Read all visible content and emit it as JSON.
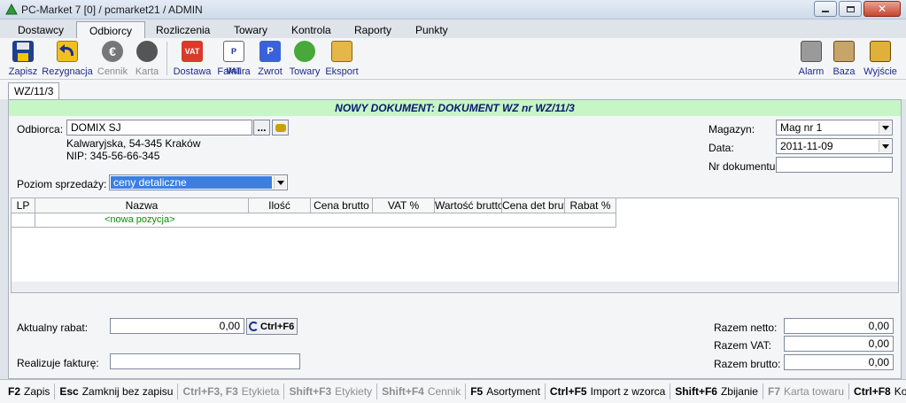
{
  "window": {
    "title": "PC-Market 7 [0] / pcmarket21 / ADMIN"
  },
  "menu": [
    {
      "label": "Dostawcy"
    },
    {
      "label": "Odbiorcy",
      "active": true
    },
    {
      "label": "Rozliczenia"
    },
    {
      "label": "Towary"
    },
    {
      "label": "Kontrola"
    },
    {
      "label": "Raporty"
    },
    {
      "label": "Punkty"
    }
  ],
  "toolbar": {
    "zapisz": "Zapisz",
    "rezygnacja": "Rezygnacja",
    "cennik": "Cennik",
    "karta": "Karta",
    "dostawa": "Dostawa",
    "faktura": "Faktura",
    "zwrot": "Zwrot",
    "towary": "Towary",
    "eksport": "Eksport",
    "alarm": "Alarm",
    "baza": "Baza",
    "wyjscie": "Wyjście"
  },
  "doc_tab": "WZ/11/3",
  "header": "NOWY DOKUMENT: DOKUMENT WZ nr WZ/11/3",
  "odbiorca": {
    "label": "Odbiorca:",
    "value": "DOMIX SJ",
    "address": "Kalwaryjska, 54-345 Kraków",
    "nip": "NIP: 345-56-66-345",
    "dots": "..."
  },
  "poziom": {
    "label": "Poziom sprzedaży:",
    "value": "ceny detaliczne"
  },
  "magazyn": {
    "label": "Magazyn:",
    "value": "Mag nr 1"
  },
  "data": {
    "label": "Data:",
    "value": "2011-11-09"
  },
  "nr_dok": {
    "label": "Nr dokumentu:",
    "value": ""
  },
  "grid": {
    "columns": [
      "LP",
      "Nazwa",
      "Ilość",
      "Cena brutto",
      "VAT %",
      "Wartość brutto",
      "Cena det brutto",
      "Rabat %"
    ],
    "new_row": "<nowa pozycja>"
  },
  "rabat": {
    "label": "Aktualny rabat:",
    "value": "0,00",
    "button": "Ctrl+F6"
  },
  "realizuje": {
    "label": "Realizuje fakturę:",
    "value": ""
  },
  "totals": {
    "netto_label": "Razem netto:",
    "netto": "0,00",
    "vat_label": "Razem VAT:",
    "vat": "0,00",
    "brutto_label": "Razem brutto:",
    "brutto": "0,00"
  },
  "statusbar": [
    {
      "key": "F2",
      "text": "Zapis",
      "enabled": true
    },
    {
      "key": "Esc",
      "text": "Zamknij bez zapisu",
      "enabled": true
    },
    {
      "key": "Ctrl+F3, F3",
      "text": "Etykieta",
      "enabled": false
    },
    {
      "key": "Shift+F3",
      "text": "Etykiety",
      "enabled": false
    },
    {
      "key": "Shift+F4",
      "text": "Cennik",
      "enabled": false
    },
    {
      "key": "F5",
      "text": "Asortyment",
      "enabled": true
    },
    {
      "key": "Ctrl+F5",
      "text": "Import z wzorca",
      "enabled": true
    },
    {
      "key": "Shift+F6",
      "text": "Zbijanie",
      "enabled": true
    },
    {
      "key": "F7",
      "text": "Karta towaru",
      "enabled": false
    },
    {
      "key": "Ctrl+F8",
      "text": "Kolumny",
      "enabled": true
    }
  ],
  "colors": {
    "header_bg": "#c6f5c6",
    "header_text": "#0a1a6e",
    "selection": "#3c7fe0",
    "new_row_text": "#0b8c0b"
  }
}
